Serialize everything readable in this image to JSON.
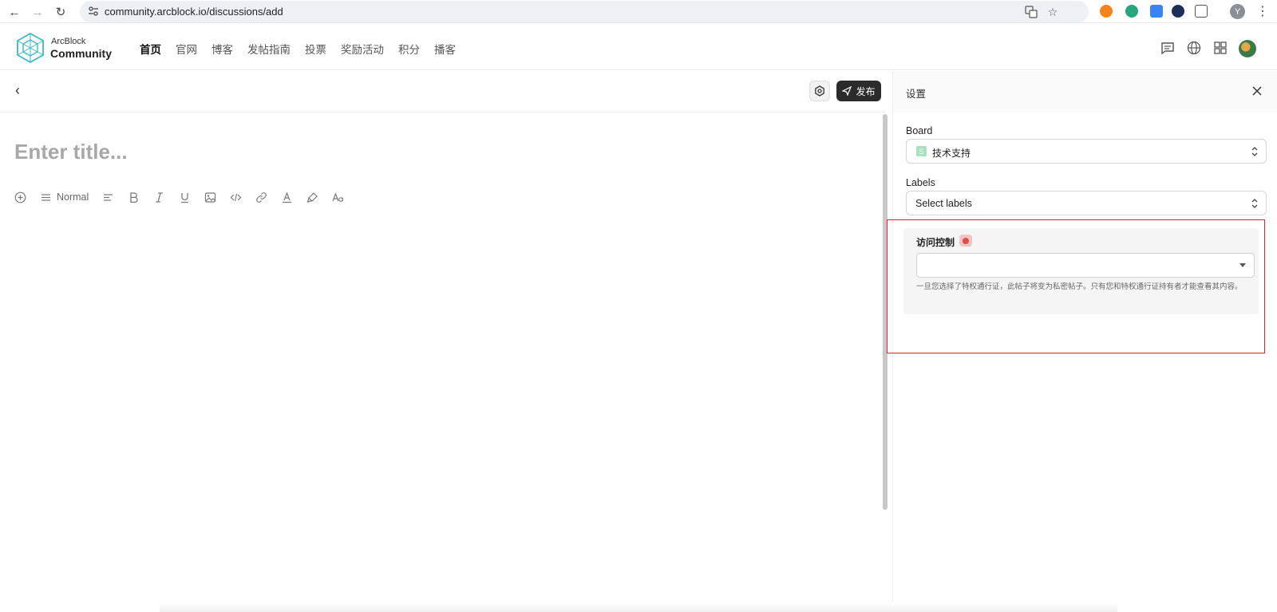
{
  "browser": {
    "url": "community.arcblock.io/discussions/add",
    "profile_initial": "Y"
  },
  "site": {
    "brand_top": "ArcBlock",
    "brand_bottom": "Community",
    "nav": [
      "首页",
      "官网",
      "博客",
      "发帖指南",
      "投票",
      "奖励活动",
      "积分",
      "播客"
    ]
  },
  "editor": {
    "title_placeholder": "Enter title...",
    "paragraph_style": "Normal",
    "publish_label": "发布"
  },
  "settings": {
    "title": "设置",
    "board_label": "Board",
    "board_badge": "S",
    "board_value": "技术支持",
    "labels_label": "Labels",
    "labels_placeholder": "Select labels",
    "access_title": "访问控制",
    "access_help": "一旦您选择了特权通行证，此帖子将变为私密帖子。只有您和特权通行证持有者才能查看其内容。"
  },
  "colors": {
    "highlight": "#d9252b",
    "brand_teal": "#3bb8c4",
    "publish_bg": "#2b2b2b"
  }
}
